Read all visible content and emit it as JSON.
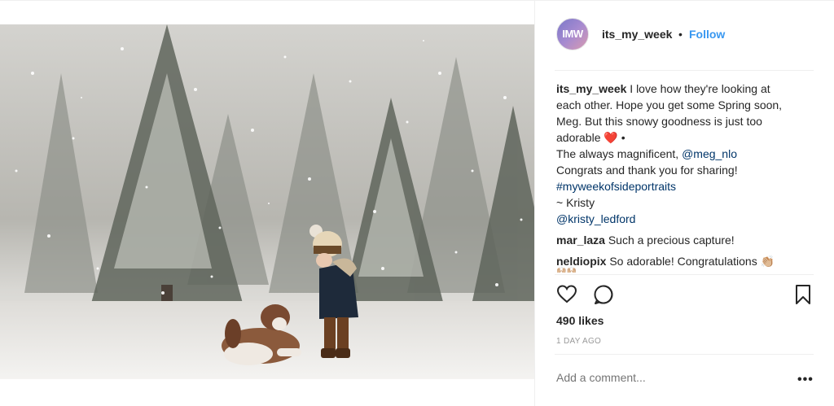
{
  "post": {
    "username": "its_my_week",
    "avatar_text": "IMW",
    "follow_separator": "•",
    "follow_label": "Follow",
    "caption": {
      "username": "its_my_week",
      "line1": "I love how they're looking at",
      "line2": "each other. Hope you get some Spring soon,",
      "line3": "Meg. But this snowy goodness is just too",
      "line4_text": "adorable",
      "line4_heart": "❤️",
      "line4_tail": "•",
      "line5_text": "The always magnificent,",
      "line5_mention": "@meg_nlo",
      "line6": "Congrats and thank you for sharing!",
      "line7_hashtag": "#myweekofsideportraits",
      "line8": "~ Kristy",
      "line9_mention": "@kristy_ledford"
    },
    "comments": [
      {
        "user": "mar_laza",
        "text": "Such a precious capture!"
      },
      {
        "user": "neldiopix",
        "text": "So adorable! Congratulations",
        "emoji": "👏🏼",
        "emoji_tail": "🙌🏼🙌🏼"
      }
    ],
    "likes": "490 likes",
    "date": "1 DAY AGO",
    "add_comment_placeholder": "Add a comment...",
    "more_label": "•••"
  },
  "icons": {
    "like": "heart-outline-icon",
    "comment": "speech-bubble-icon",
    "save": "bookmark-icon"
  },
  "colors": {
    "link_blue": "#3897f0",
    "mention_dark": "#003569",
    "heart_red": "#e0202c"
  }
}
